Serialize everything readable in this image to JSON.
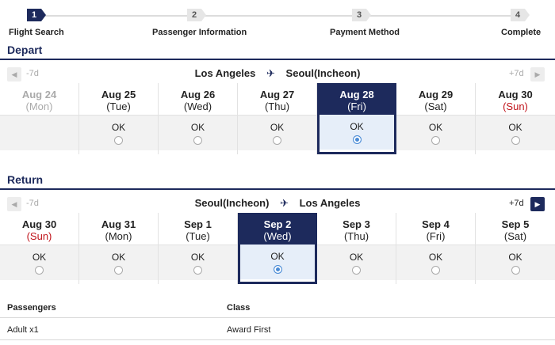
{
  "steps": [
    {
      "num": "1",
      "label": "Flight Search",
      "active": true
    },
    {
      "num": "2",
      "label": "Passenger Information",
      "active": false
    },
    {
      "num": "3",
      "label": "Payment Method",
      "active": false
    },
    {
      "num": "4",
      "label": "Complete",
      "active": false
    }
  ],
  "depart": {
    "title": "Depart",
    "prev_label": "-7d",
    "next_label": "+7d",
    "prev_arrow": "◀",
    "next_arrow": "▶",
    "origin": "Los Angeles",
    "destination": "Seoul(Incheon)",
    "plane_icon": "✈",
    "days": [
      {
        "date": "Aug 24",
        "dow": "(Mon)",
        "status": "",
        "disabled": true,
        "selected": false,
        "sunday": false
      },
      {
        "date": "Aug 25",
        "dow": "(Tue)",
        "status": "OK",
        "disabled": false,
        "selected": false,
        "sunday": false
      },
      {
        "date": "Aug 26",
        "dow": "(Wed)",
        "status": "OK",
        "disabled": false,
        "selected": false,
        "sunday": false
      },
      {
        "date": "Aug 27",
        "dow": "(Thu)",
        "status": "OK",
        "disabled": false,
        "selected": false,
        "sunday": false
      },
      {
        "date": "Aug 28",
        "dow": "(Fri)",
        "status": "OK",
        "disabled": false,
        "selected": true,
        "sunday": false
      },
      {
        "date": "Aug 29",
        "dow": "(Sat)",
        "status": "OK",
        "disabled": false,
        "selected": false,
        "sunday": false
      },
      {
        "date": "Aug 30",
        "dow": "(Sun)",
        "status": "OK",
        "disabled": false,
        "selected": false,
        "sunday": true
      }
    ]
  },
  "return": {
    "title": "Return",
    "prev_label": "-7d",
    "next_label": "+7d",
    "prev_arrow": "◀",
    "next_arrow": "▶",
    "origin": "Seoul(Incheon)",
    "destination": "Los Angeles",
    "plane_icon": "✈",
    "days": [
      {
        "date": "Aug 30",
        "dow": "(Sun)",
        "status": "OK",
        "disabled": false,
        "selected": false,
        "sunday": true
      },
      {
        "date": "Aug 31",
        "dow": "(Mon)",
        "status": "OK",
        "disabled": false,
        "selected": false,
        "sunday": false
      },
      {
        "date": "Sep 1",
        "dow": "(Tue)",
        "status": "OK",
        "disabled": false,
        "selected": false,
        "sunday": false
      },
      {
        "date": "Sep 2",
        "dow": "(Wed)",
        "status": "OK",
        "disabled": false,
        "selected": true,
        "sunday": false
      },
      {
        "date": "Sep 3",
        "dow": "(Thu)",
        "status": "OK",
        "disabled": false,
        "selected": false,
        "sunday": false
      },
      {
        "date": "Sep 4",
        "dow": "(Fri)",
        "status": "OK",
        "disabled": false,
        "selected": false,
        "sunday": false
      },
      {
        "date": "Sep 5",
        "dow": "(Sat)",
        "status": "OK",
        "disabled": false,
        "selected": false,
        "sunday": false
      }
    ]
  },
  "summary": {
    "passengers_header": "Passengers",
    "class_header": "Class",
    "passengers_value": "Adult x1",
    "class_value": "Award First"
  }
}
